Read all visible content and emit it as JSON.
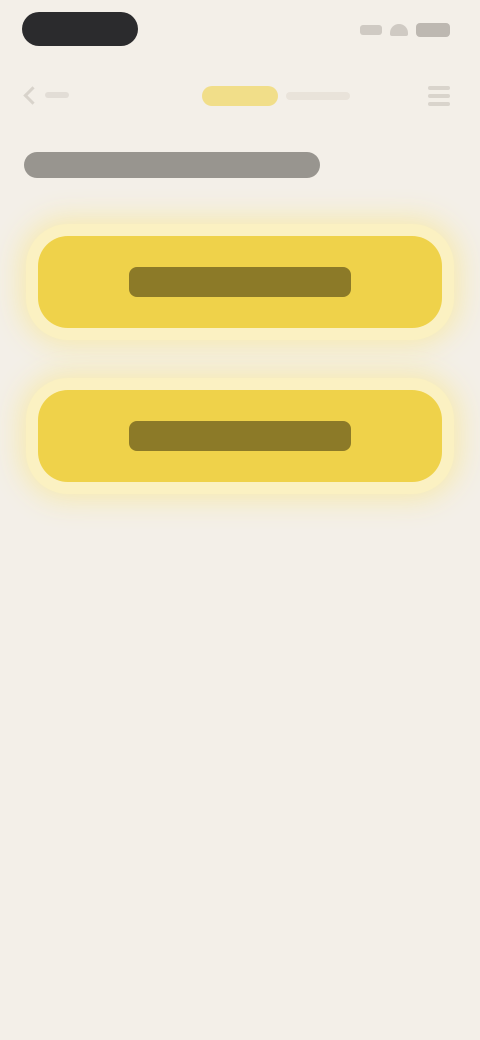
{
  "status_bar": {
    "time": "",
    "icons": [
      "signal-icon",
      "wifi-icon",
      "battery-icon"
    ]
  },
  "top_bar": {
    "left_icon": "back-icon",
    "right_icon": "menu-icon"
  },
  "page": {
    "title": ""
  },
  "choices": [
    {
      "label": ""
    },
    {
      "label": ""
    }
  ],
  "colors": {
    "background": "#f3efe8",
    "accent": "#efd24a",
    "accent_glow": "#fbf1c2",
    "dark": "#2b2b2d"
  }
}
